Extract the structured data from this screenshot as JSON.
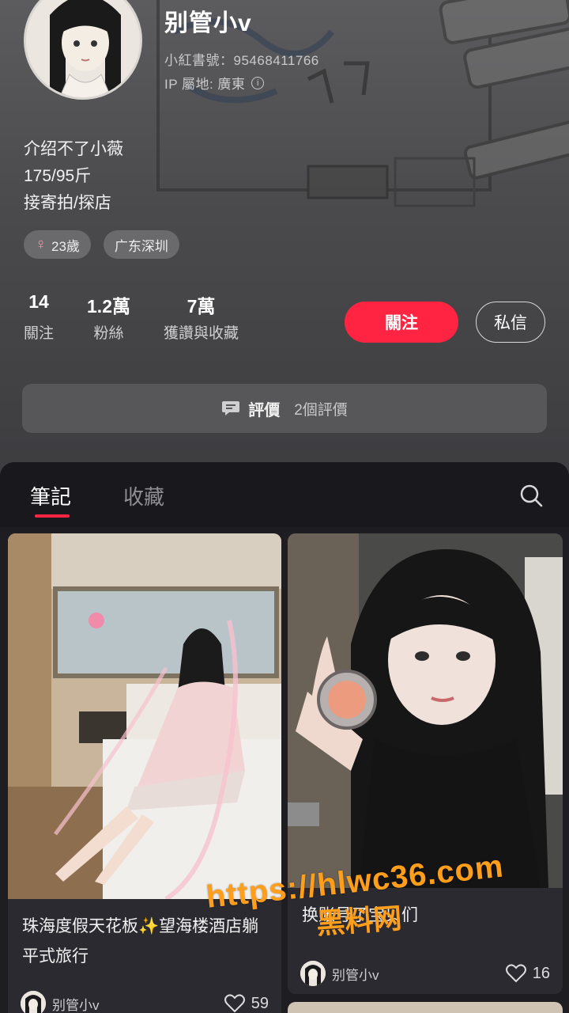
{
  "profile": {
    "name": "别管小v",
    "red_id": "小紅書號：95468411766",
    "ip_location": "IP 屬地: 廣東",
    "bio": [
      "介绍不了小薇",
      "175/95斤",
      "接寄拍/探店"
    ],
    "tags": [
      {
        "icon": "venus-icon",
        "label": "23歲"
      },
      {
        "label": "广东深圳"
      }
    ],
    "stats": [
      {
        "value": "14",
        "label": "關注"
      },
      {
        "value": "1.2萬",
        "label": "粉絲"
      },
      {
        "value": "7萬",
        "label": "獲讚與收藏"
      }
    ],
    "follow_label": "關注",
    "message_label": "私信",
    "review": {
      "icon": "comment-icon",
      "title": "評價",
      "count": "2個評價"
    }
  },
  "tabs": {
    "items": [
      {
        "label": "筆記",
        "active": true
      },
      {
        "label": "收藏",
        "active": false
      }
    ],
    "search_icon": "search-icon"
  },
  "notes": [
    {
      "title": "珠海度假天花板✨望海楼酒店躺平式旅行",
      "author": "别管小v",
      "likes": "59"
    },
    {
      "title": "换账号了宝贝们",
      "author": "别管小v",
      "likes": "16"
    }
  ],
  "watermark": {
    "line1": "https://hlwc36.com",
    "line2": "黑料网"
  },
  "colors": {
    "accent": "#ff2442",
    "background": "#1d1d22",
    "watermark": "#ff9e1b"
  }
}
